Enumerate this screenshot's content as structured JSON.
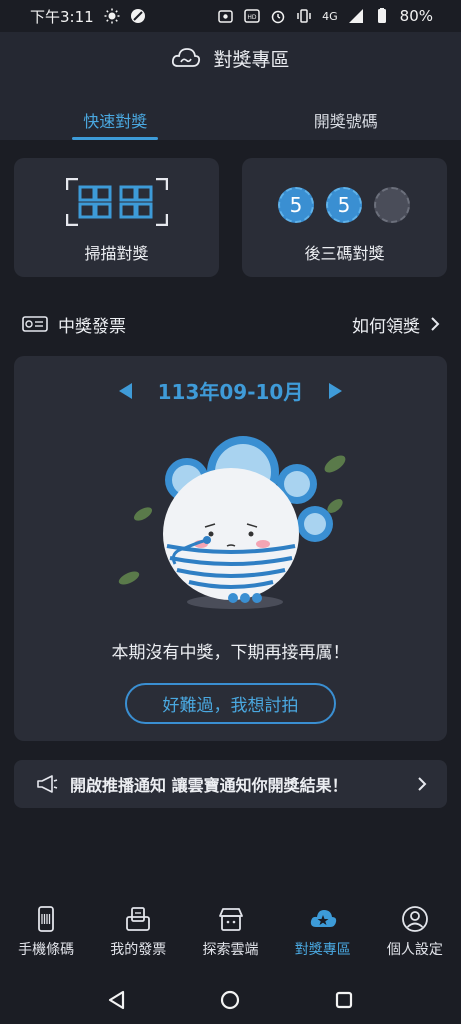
{
  "status_bar": {
    "time": "下午3:11",
    "battery": "80%",
    "network": "4G"
  },
  "header": {
    "title": "對獎專區"
  },
  "tabs": [
    {
      "label": "快速對獎"
    },
    {
      "label": "開獎號碼"
    }
  ],
  "quick_cards": {
    "scan_label": "掃描對獎",
    "last3_label": "後三碼對獎",
    "digits": [
      "5",
      "5",
      ""
    ]
  },
  "section": {
    "title": "中獎發票",
    "how_to": "如何領獎"
  },
  "result_card": {
    "period": "113年09-10月",
    "message": "本期沒有中獎，下期再接再厲！",
    "button": "好難過，我想討拍"
  },
  "notify": {
    "text": "開啟推播通知 讓雲寶通知你開獎結果！"
  },
  "bottom_nav": [
    {
      "label": "手機條碼"
    },
    {
      "label": "我的發票"
    },
    {
      "label": "探索雲端"
    },
    {
      "label": "對獎專區"
    },
    {
      "label": "個人設定"
    }
  ],
  "colors": {
    "accent": "#3d9bd8",
    "background": "#1b1d24",
    "card": "#2a2d37"
  }
}
